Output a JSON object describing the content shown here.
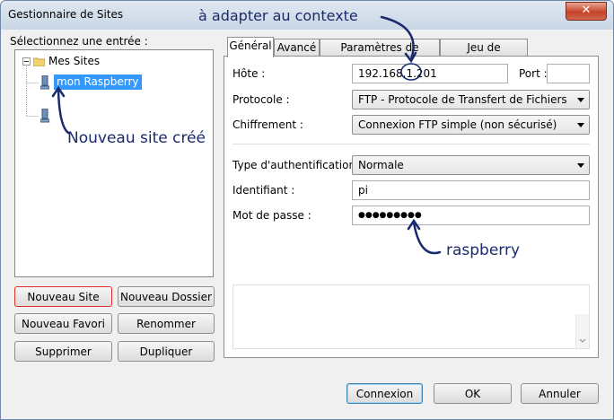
{
  "window": {
    "title": "Gestionnaire de Sites",
    "close_label": "✕"
  },
  "tree": {
    "label": "Sélectionnez une entrée :",
    "root": "Mes Sites",
    "items": [
      "mon Raspberry",
      ""
    ]
  },
  "left_buttons": {
    "new_site": "Nouveau Site",
    "new_folder": "Nouveau Dossier",
    "new_bookmark": "Nouveau Favori",
    "rename": "Renommer",
    "delete": "Supprimer",
    "duplicate": "Dupliquer"
  },
  "tabs": [
    "Général",
    "Avancé",
    "Paramètres de transfert",
    "Jeu de caractères"
  ],
  "form": {
    "host_label": "Hôte :",
    "host_value": "192.168.1.201",
    "port_label": "Port :",
    "port_value": "",
    "protocol_label": "Protocole :",
    "protocol_value": "FTP - Protocole de Transfert de Fichiers",
    "encryption_label": "Chiffrement :",
    "encryption_value": "Connexion FTP simple (non sécurisé)",
    "auth_label": "Type d'authentification :",
    "auth_value": "Normale",
    "user_label": "Identifiant :",
    "user_value": "pi",
    "password_label": "Mot de passe :",
    "password_value": "●●●●●●●●●"
  },
  "footer_buttons": {
    "connect": "Connexion",
    "ok": "OK",
    "cancel": "Annuler"
  },
  "annotations": {
    "adapt": "à adapter au contexte",
    "new_site": "Nouveau site créé",
    "password": "raspberry"
  },
  "colors": {
    "selection": "#3399ff",
    "annotation": "#1a2a6c",
    "highlight_border": "#e03030"
  }
}
